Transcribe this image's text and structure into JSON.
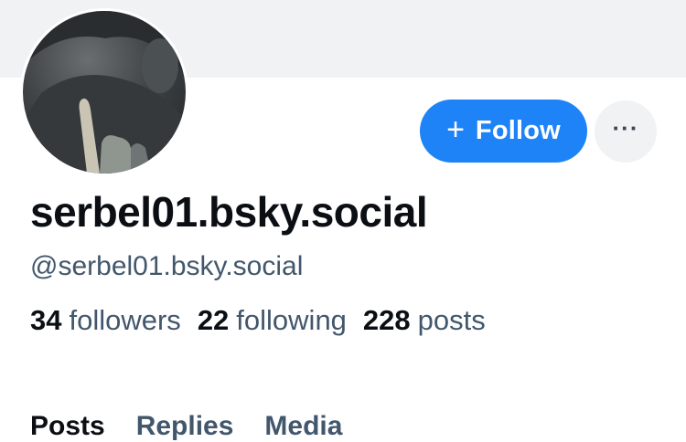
{
  "profile": {
    "display_name": "serbel01.bsky.social",
    "handle": "@serbel01.bsky.social",
    "avatar_icon": "profile-photo-gorilla-hand"
  },
  "actions": {
    "follow_label": "Follow",
    "follow_icon": "+",
    "more_icon": "···",
    "accent_color": "#1e83f7"
  },
  "stats": {
    "followers": {
      "count": "34",
      "label": "followers"
    },
    "following": {
      "count": "22",
      "label": "following"
    },
    "posts": {
      "count": "228",
      "label": "posts"
    }
  },
  "tabs": [
    {
      "label": "Posts"
    },
    {
      "label": "Replies"
    },
    {
      "label": "Media"
    }
  ]
}
